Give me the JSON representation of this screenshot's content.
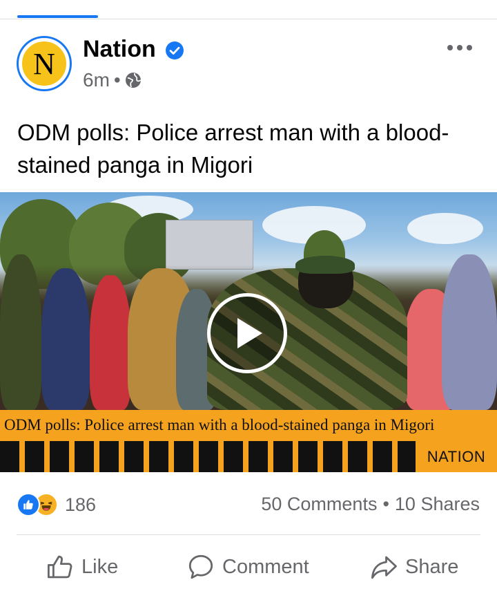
{
  "page": {
    "name": "Nation",
    "verified": true,
    "time": "6m",
    "audience_icon": "globe-icon",
    "avatar_letter": "N"
  },
  "post": {
    "text": "ODM polls: Police arrest man with a blood-stained panga in Migori",
    "media": {
      "type": "video",
      "caption": "ODM polls: Police arrest man with a blood-stained panga in Migori",
      "brand": "NATION",
      "play_icon": "play-icon"
    }
  },
  "stats": {
    "reaction_icons": [
      "like-icon",
      "haha-icon"
    ],
    "reactions": "186",
    "comments": "50 Comments",
    "separator": "•",
    "shares": "10 Shares"
  },
  "actions": {
    "like": "Like",
    "comment": "Comment",
    "share": "Share"
  },
  "colors": {
    "accent": "#1877f2",
    "caption_bar": "#f5a21f",
    "secondary_text": "#65676b"
  }
}
